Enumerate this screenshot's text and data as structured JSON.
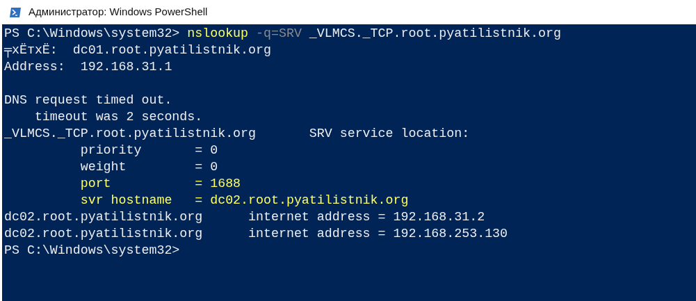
{
  "window": {
    "title": "Администратор: Windows PowerShell"
  },
  "console": {
    "lines": [
      [
        {
          "kind": "normal",
          "text": "PS C:\\Windows\\system32> "
        },
        {
          "kind": "command",
          "text": "nslookup"
        },
        {
          "kind": "parameter",
          "text": " -q=SRV"
        },
        {
          "kind": "normal",
          "text": " _VLMCS._TCP.root.pyatilistnik.org"
        }
      ],
      [
        {
          "kind": "normal",
          "text": "╤хЁтхЁ:  dc01.root.pyatilistnik.org"
        }
      ],
      [
        {
          "kind": "normal",
          "text": "Address:  192.168.31.1"
        }
      ],
      {
        "kind": "blank"
      },
      [
        {
          "kind": "normal",
          "text": "DNS request timed out."
        }
      ],
      [
        {
          "kind": "normal",
          "text": "    timeout was 2 seconds."
        }
      ],
      [
        {
          "kind": "normal",
          "text": "_VLMCS._TCP.root.pyatilistnik.org       SRV service location:"
        }
      ],
      [
        {
          "kind": "normal",
          "text": "          priority       = 0"
        }
      ],
      [
        {
          "kind": "normal",
          "text": "          weight         = 0"
        }
      ],
      [
        {
          "kind": "highlight",
          "text": "          port           = 1688"
        }
      ],
      [
        {
          "kind": "highlight",
          "text": "          svr hostname   = dc02.root.pyatilistnik.org"
        }
      ],
      [
        {
          "kind": "normal",
          "text": "dc02.root.pyatilistnik.org      internet address = 192.168.31.2"
        }
      ],
      [
        {
          "kind": "normal",
          "text": "dc02.root.pyatilistnik.org      internet address = 192.168.253.130"
        }
      ],
      [
        {
          "kind": "normal",
          "text": "PS C:\\Windows\\system32>"
        }
      ]
    ]
  }
}
